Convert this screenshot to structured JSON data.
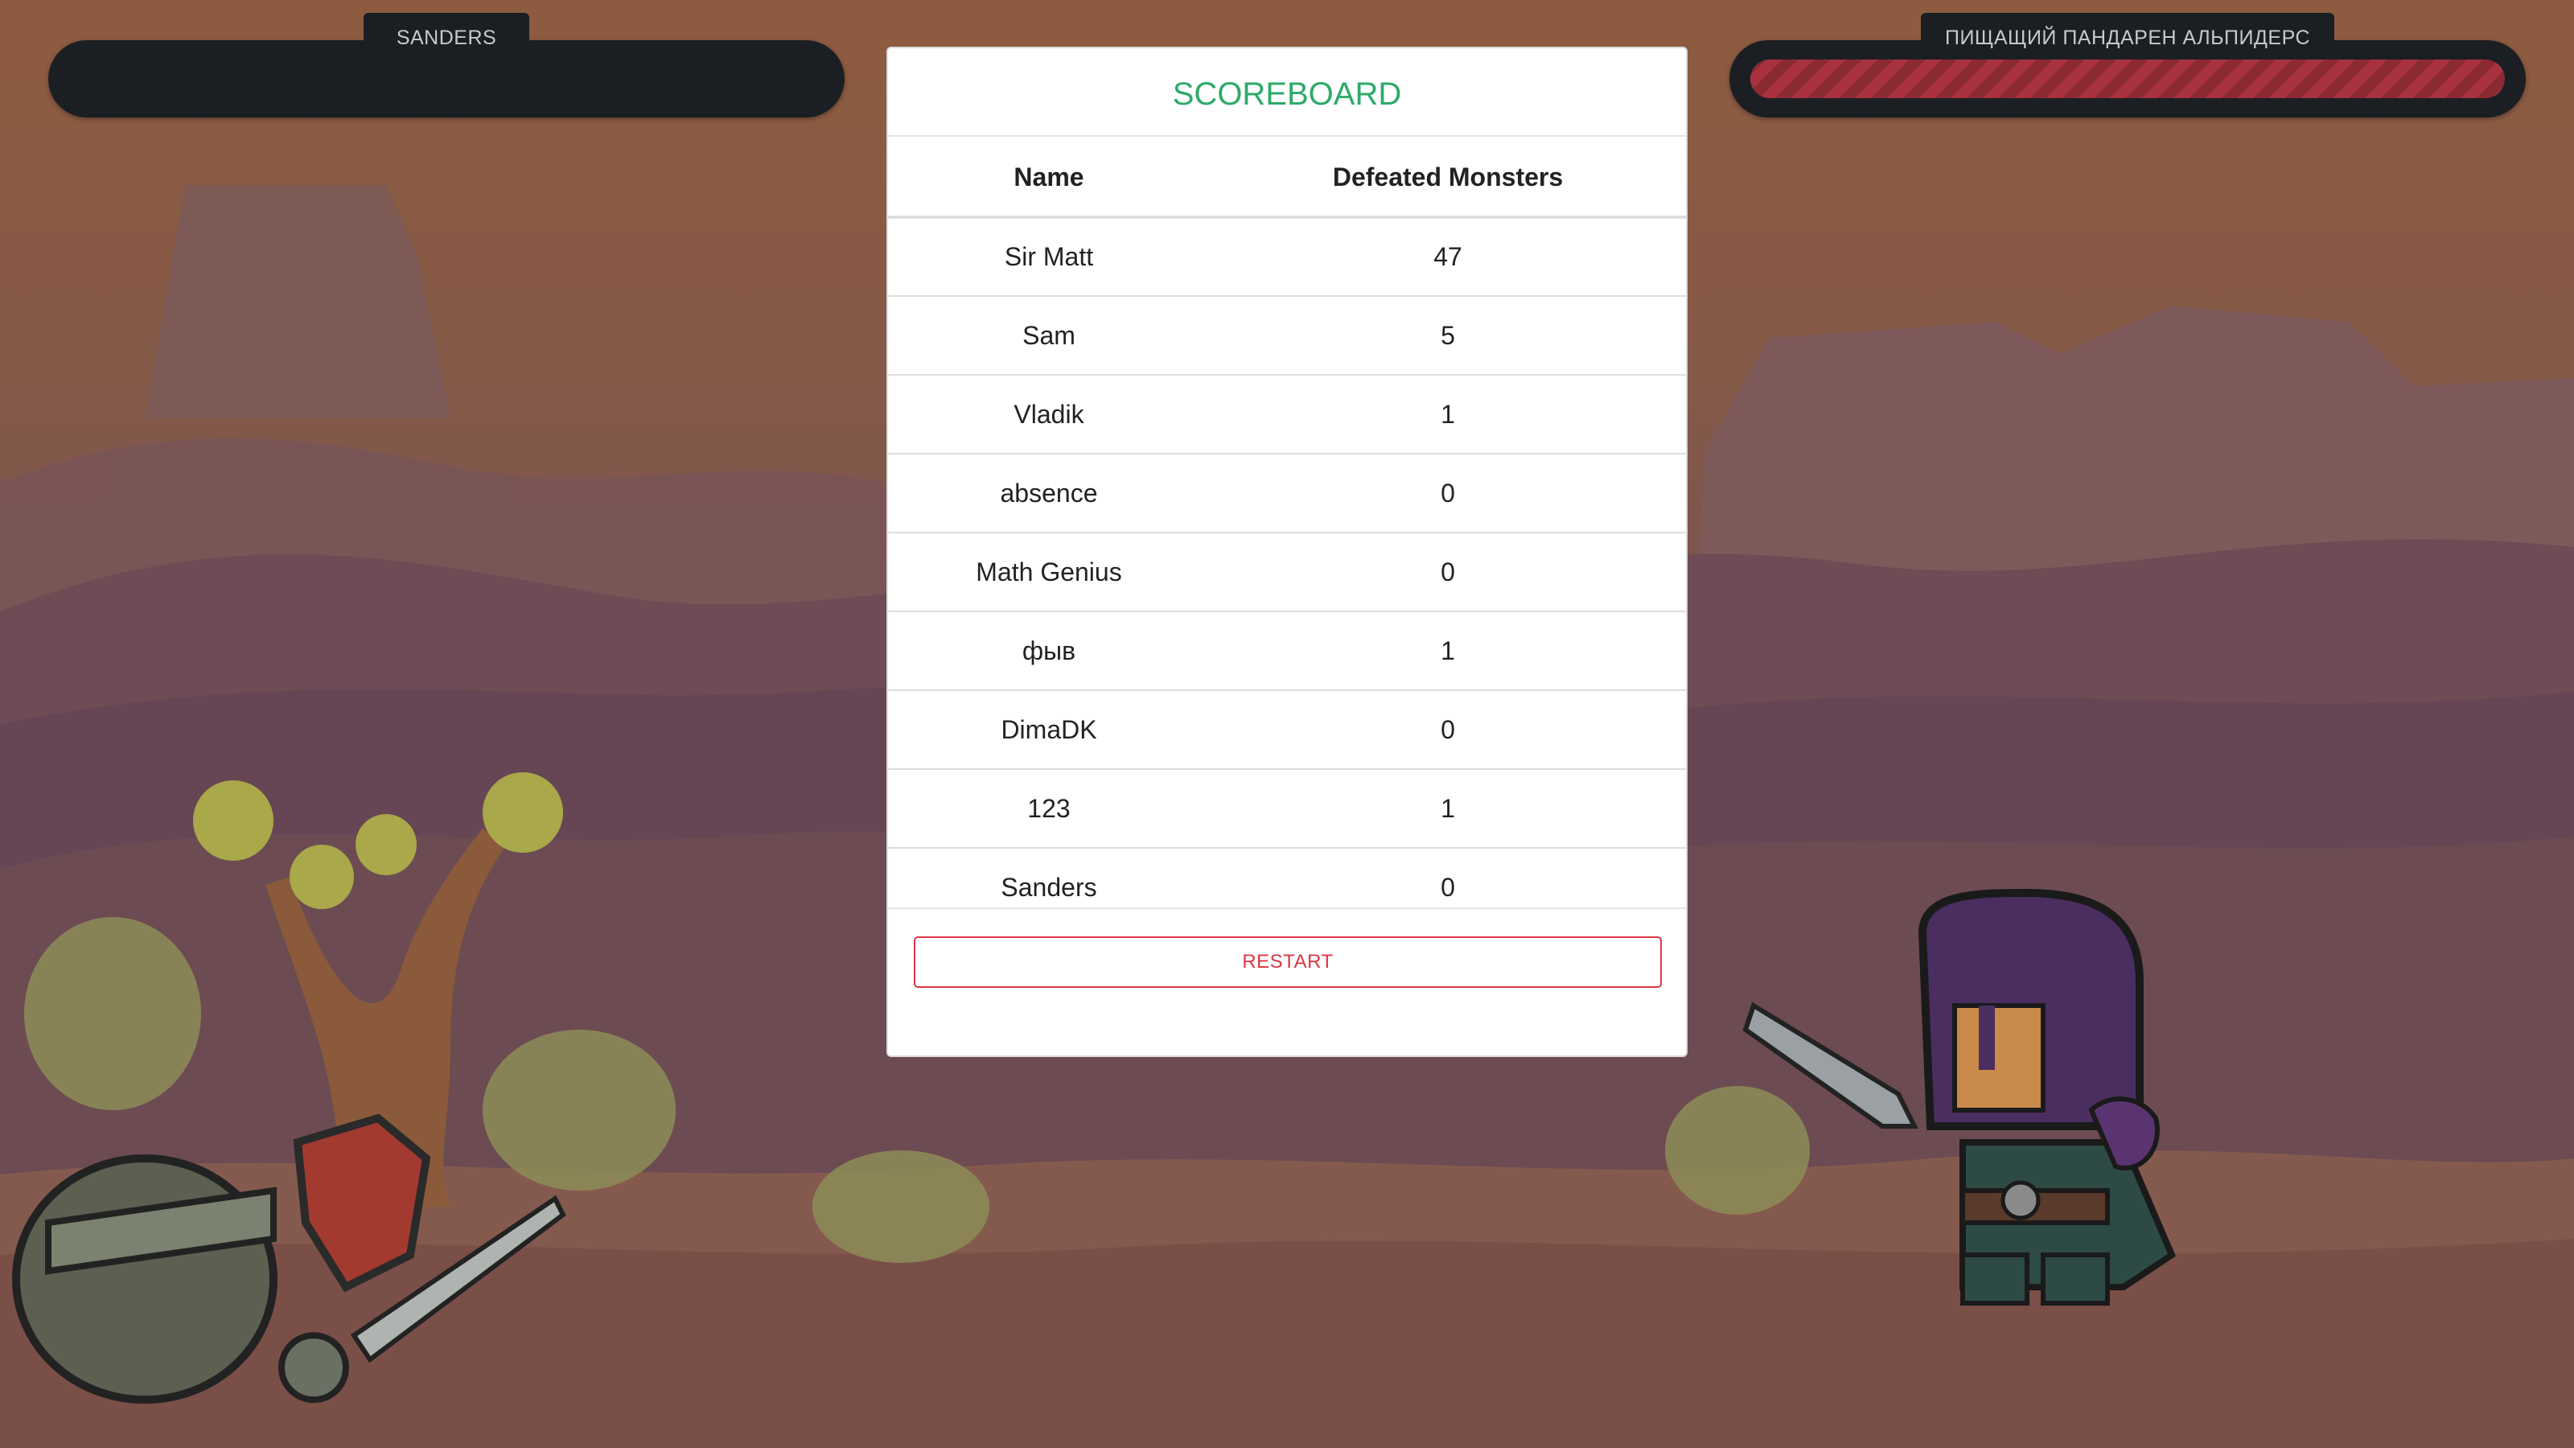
{
  "player": {
    "name": "SANDERS",
    "health": 0
  },
  "enemy": {
    "name": "ПИЩАЩИЙ ПАНДАРЕН АЛЬПИДЕРС",
    "health": 1.0
  },
  "scoreboard": {
    "title": "SCOREBOARD",
    "headers": {
      "name": "Name",
      "defeated": "Defeated Monsters"
    },
    "rows": [
      {
        "name": "Sir Matt",
        "defeated": "47"
      },
      {
        "name": "Sam",
        "defeated": "5"
      },
      {
        "name": "Vladik",
        "defeated": "1"
      },
      {
        "name": "absence",
        "defeated": "0"
      },
      {
        "name": "Math Genius",
        "defeated": "0"
      },
      {
        "name": "фыв",
        "defeated": "1"
      },
      {
        "name": "DimaDK",
        "defeated": "0"
      },
      {
        "name": "123",
        "defeated": "1"
      },
      {
        "name": "Sanders",
        "defeated": "0"
      }
    ],
    "restart_label": "RESTART"
  },
  "colors": {
    "title": "#2eaa6a",
    "restart": "#dc3545",
    "health_fill": "#a8323e",
    "bar_bg": "#1b1f23"
  },
  "icons": {
    "player_character": "knight-icon",
    "enemy_character": "purple-helmet-warrior-icon"
  }
}
